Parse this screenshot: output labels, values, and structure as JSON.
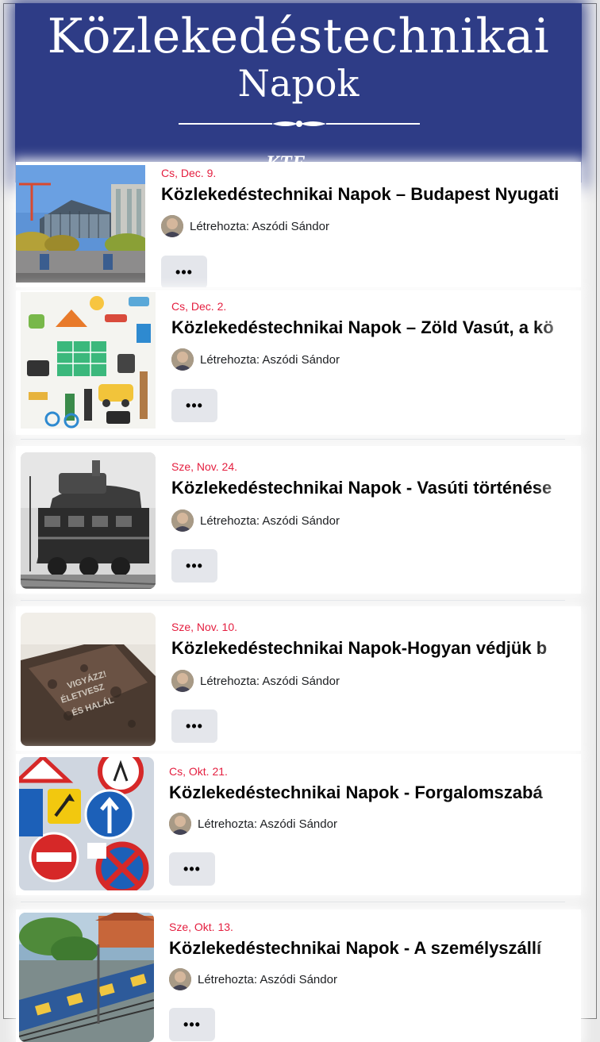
{
  "banner": {
    "title": "Közlekedéstechnikai",
    "subtitle": "Napok",
    "tag": "KTE",
    "color": "#2e3c86"
  },
  "events": [
    {
      "date": "Cs, Dec. 9.",
      "title": "Közlekedéstechnikai Napok – Budapest Nyugati",
      "creator": "Létrehozta: Aszódi Sándor",
      "more": "•••",
      "thumb": "station-photo"
    },
    {
      "date": "Cs, Dec. 2.",
      "title": "Közlekedéstechnikai Napok – Zöld Vasút, a kö",
      "creator": "Létrehozta: Aszódi Sándor",
      "more": "•••",
      "thumb": "travel-items-illustration"
    },
    {
      "date": "Sze, Nov. 24.",
      "title": "Közlekedéstechnikai Napok - Vasúti történése",
      "creator": "Létrehozta: Aszódi Sándor",
      "more": "•••",
      "thumb": "old-locomotive-photo"
    },
    {
      "date": "Sze, Nov. 10.",
      "title": "Közlekedéstechnikai Napok-Hogyan védjük b",
      "creator": "Létrehozta: Aszódi Sándor",
      "more": "•••",
      "thumb": "warning-plaque-photo"
    },
    {
      "date": "Cs, Okt. 21.",
      "title": "Közlekedéstechnikai Napok - Forgalomszabá",
      "creator": "Létrehozta: Aszódi Sándor",
      "more": "•••",
      "thumb": "traffic-signs-photo"
    },
    {
      "date": "Sze, Okt. 13.",
      "title": "Közlekedéstechnikai Napok - A személyszállí",
      "creator": "Létrehozta: Aszódi Sándor",
      "more": "•••",
      "thumb": "tram-photo"
    }
  ],
  "colors": {
    "date": "#e41e3f",
    "button_bg": "#e4e6eb"
  }
}
